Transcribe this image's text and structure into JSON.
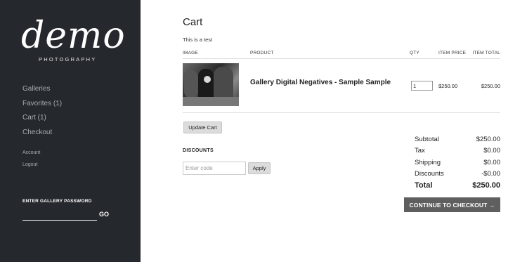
{
  "sidebar": {
    "logo_script": "demo",
    "logo_sub": "PHOTOGRAPHY",
    "nav": [
      "Galleries",
      "Favorites (1)",
      "Cart (1)",
      "Checkout"
    ],
    "subnav": [
      "Account",
      "Logout"
    ],
    "password_label": "ENTER GALLERY PASSWORD",
    "password_value": "",
    "go_label": "GO"
  },
  "cart": {
    "title": "Cart",
    "subtitle": "This is a test",
    "columns": {
      "image": "IMAGE",
      "product": "PRODUCT",
      "qty": "QTY",
      "item_price": "ITEM PRICE",
      "item_total": "ITEM TOTAL"
    },
    "items": [
      {
        "product": "Gallery Digital Negatives - Sample Sample",
        "qty": "1",
        "item_price": "$250.00",
        "item_total": "$250.00"
      }
    ],
    "update_label": "Update Cart",
    "discounts_heading": "DISCOUNTS",
    "code_placeholder": "Enter code",
    "apply_label": "Apply",
    "summary": [
      {
        "label": "Subtotal",
        "value": "$250.00"
      },
      {
        "label": "Tax",
        "value": "$0.00"
      },
      {
        "label": "Shipping",
        "value": "$0.00"
      },
      {
        "label": "Discounts",
        "value": "-$0.00"
      },
      {
        "label": "Total",
        "value": "$250.00"
      }
    ],
    "checkout_label": "CONTINUE TO CHECKOUT →"
  }
}
